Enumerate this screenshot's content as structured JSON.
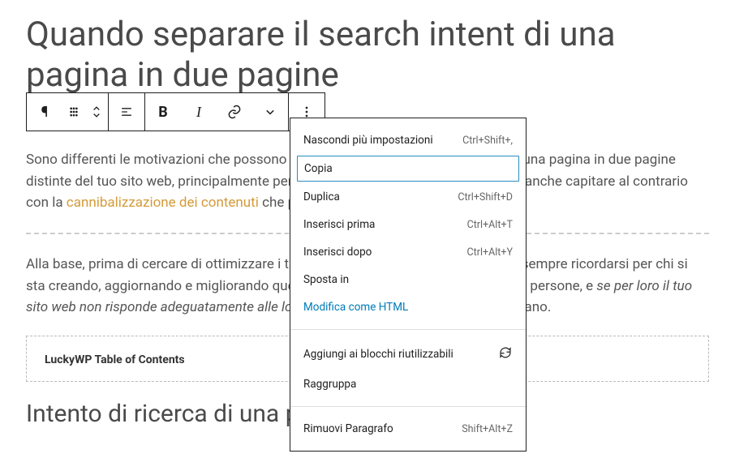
{
  "title": "Quando separare il search intent di una pagina in due pagine",
  "paragraph1_before_link": "Sono differenti le motivazioni che possono spingerti a separare il search intent di una pagina in due pagine distinte del tuo sito web, principalmente perché a volte ci si arriva per gradi, e può anche capitare al contrario con la ",
  "paragraph1_link": "cannibalizzazione dei contenuti",
  "paragraph1_after_link": " che poco dopo andiamo a vedere.",
  "paragraph2_plain": "Alla base, prima di cercare di ottimizzare i tuoi articoli, pagine e prodotti, bisogna sempre ricordarsi per chi si sta creando, aggiornando e migliorando quella data pagina: gli utenti, vale a dire le persone, e ",
  "paragraph2_em": "se per loro il tuo sito web non risponde adeguatamente alle loro richieste",
  "paragraph2_tail": ", allora è meglio metterci mano.",
  "toc_title": "LuckyWP Table of Contents",
  "heading2": "Intento di ricerca di una pagina",
  "menu": {
    "hide_more": "Nascondi più impostazioni",
    "hide_more_sc": "Ctrl+Shift+,",
    "copy": "Copia",
    "duplicate": "Duplica",
    "duplicate_sc": "Ctrl+Shift+D",
    "insert_before": "Inserisci prima",
    "insert_before_sc": "Ctrl+Alt+T",
    "insert_after": "Inserisci dopo",
    "insert_after_sc": "Ctrl+Alt+Y",
    "move_to": "Sposta in",
    "edit_html": "Modifica come HTML",
    "add_reusable": "Aggiungi ai blocchi riutilizzabili",
    "group": "Raggruppa",
    "remove": "Rimuovi Paragrafo",
    "remove_sc": "Shift+Alt+Z"
  }
}
